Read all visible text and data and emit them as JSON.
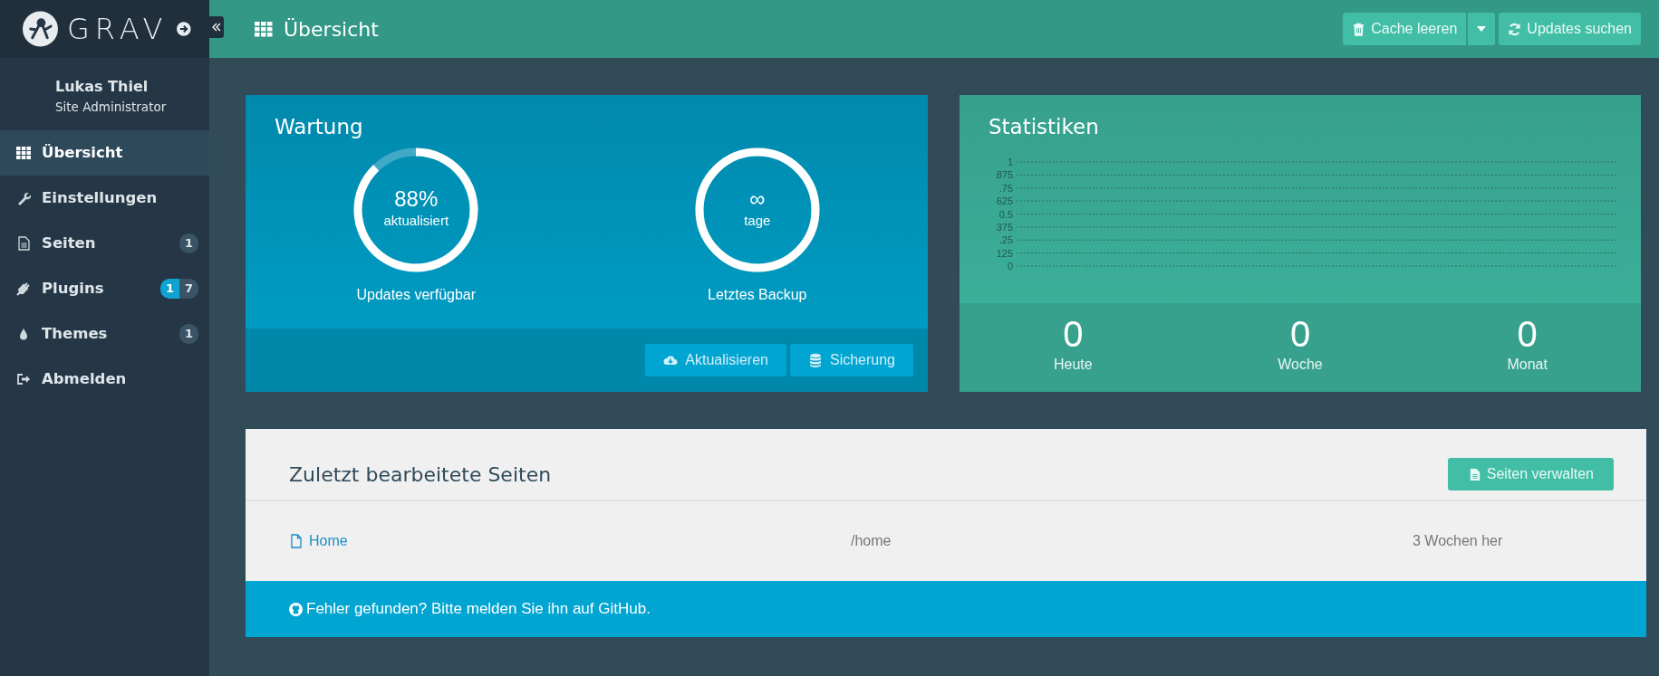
{
  "sidebar": {
    "brand": "GRAV",
    "user": {
      "name": "Lukas Thiel",
      "role": "Site Administrator"
    },
    "items": [
      {
        "label": "Übersicht",
        "selected": true
      },
      {
        "label": "Einstellungen",
        "selected": false
      },
      {
        "label": "Seiten",
        "selected": false,
        "badges": [
          {
            "text": "1",
            "kind": "count"
          }
        ]
      },
      {
        "label": "Plugins",
        "selected": false,
        "badges": [
          {
            "text": "1",
            "kind": "update"
          },
          {
            "text": "7",
            "kind": "count"
          }
        ]
      },
      {
        "label": "Themes",
        "selected": false,
        "badges": [
          {
            "text": "1",
            "kind": "count"
          }
        ]
      },
      {
        "label": "Abmelden",
        "selected": false
      }
    ]
  },
  "header": {
    "title": "Übersicht",
    "buttons": [
      {
        "label": "Cache leeren",
        "kind": "split"
      },
      {
        "label": "Updates suchen",
        "kind": "plain"
      }
    ]
  },
  "maintenance": {
    "title": "Wartung",
    "gauges": [
      {
        "value": "88%",
        "unit": "aktualisiert",
        "caption": "Updates verfügbar",
        "level": 0.88
      },
      {
        "value": "∞",
        "unit": "tage",
        "caption": "Letztes Backup",
        "level": 1
      }
    ],
    "buttons": [
      {
        "label": "Aktualisieren"
      },
      {
        "label": "Sicherung"
      }
    ]
  },
  "statistics": {
    "title": "Statistiken",
    "axis_labels": [
      "1",
      "875",
      ".75",
      "625",
      "0.5",
      "375",
      ".25",
      "125",
      "0"
    ],
    "counters": [
      {
        "value": "0",
        "label": "Heute"
      },
      {
        "value": "0",
        "label": "Woche"
      },
      {
        "value": "0",
        "label": "Monat"
      }
    ]
  },
  "recent": {
    "title": "Zuletzt bearbeitete Seiten",
    "button": "Seiten verwalten",
    "rows": [
      {
        "title": "Home",
        "route": "/home",
        "modified": "3 Wochen her"
      }
    ]
  },
  "footer": {
    "text": "Fehler gefunden? Bitte melden Sie ihn auf GitHub."
  }
}
